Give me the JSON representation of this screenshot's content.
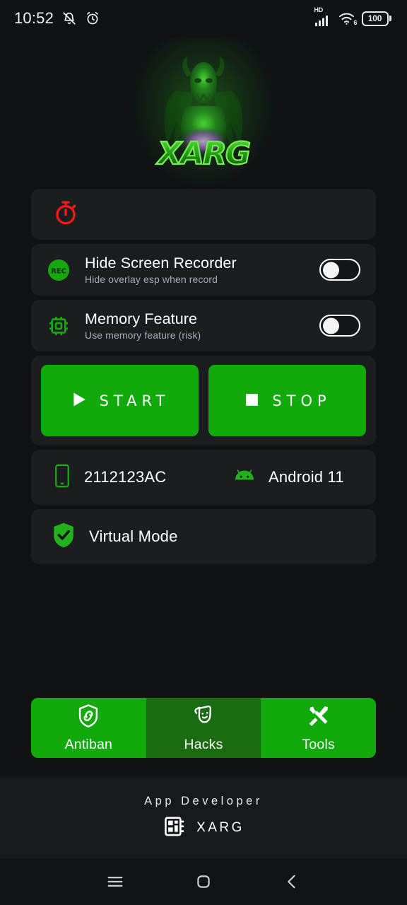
{
  "statusbar": {
    "time": "10:52",
    "left_icons": [
      "mute-bell-icon",
      "alarm-clock-icon"
    ],
    "network_label": "HD",
    "wifi_label": "6",
    "battery_level": "100"
  },
  "logo": {
    "name": "xarg-logo",
    "wordmark": "XARG",
    "glow_color": "#3ddc28"
  },
  "timer_card": {
    "icon": "stopwatch-icon",
    "icon_color": "#ED1C16",
    "label": ""
  },
  "settings": [
    {
      "icon": "rec-icon",
      "icon_text": "REC",
      "title": "Hide Screen Recorder",
      "subtitle": "Hide overlay esp when record",
      "toggle_state": "off"
    },
    {
      "icon": "memory-chip-icon",
      "icon_text": "",
      "title": "Memory Feature",
      "subtitle": "Use memory feature (risk)",
      "toggle_state": "off"
    }
  ],
  "actions": {
    "start_label": "START",
    "start_icon": "play-icon",
    "stop_label": "STOP",
    "stop_icon": "stop-icon",
    "button_color": "#12A90C"
  },
  "device": {
    "phone_icon": "smartphone-icon",
    "model": "2112123AC",
    "android_icon": "android-icon",
    "os_version": "Android 11"
  },
  "virtual_mode": {
    "icon": "shield-check-icon",
    "label": "Virtual Mode"
  },
  "tabs": [
    {
      "label": "Antiban",
      "icon": "shield-link-icon",
      "selected": true
    },
    {
      "label": "Hacks",
      "icon": "theater-masks-icon",
      "selected": false
    },
    {
      "label": "Tools",
      "icon": "wrench-screwdriver-icon",
      "selected": true
    }
  ],
  "footer": {
    "title": "App Developer",
    "icon": "chip-badge-icon",
    "developer": "XARG"
  },
  "navbar": {
    "recents_label": "recents-icon",
    "home_label": "home-icon",
    "back_label": "back-icon"
  },
  "colors": {
    "accent_green": "#12A90C",
    "dark_green": "#1A6B12",
    "card_bg": "#1b1d20",
    "page_bg": "#101214",
    "red": "#ED1C16"
  }
}
